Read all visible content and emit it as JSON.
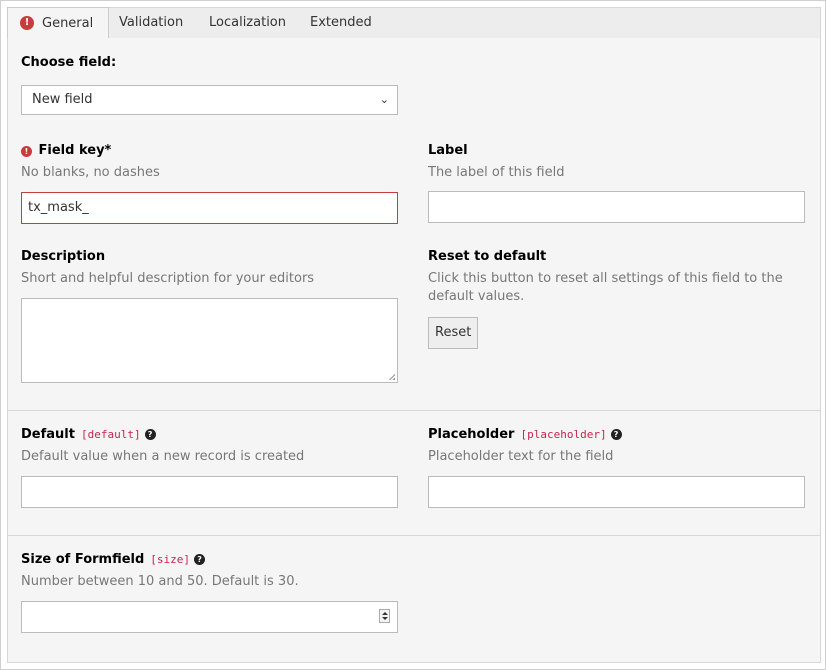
{
  "tabs": [
    {
      "label": "General",
      "active": true,
      "has_error": true
    },
    {
      "label": "Validation"
    },
    {
      "label": "Localization"
    },
    {
      "label": "Extended"
    }
  ],
  "choose_field": {
    "label": "Choose field:",
    "selected": "New field"
  },
  "field_key": {
    "label": "Field key*",
    "description": "No blanks, no dashes",
    "value": "tx_mask_"
  },
  "label_field": {
    "label": "Label",
    "description": "The label of this field",
    "value": ""
  },
  "description_field": {
    "label": "Description",
    "description": "Short and helpful description for your editors",
    "value": ""
  },
  "reset": {
    "label": "Reset to default",
    "description": "Click this button to reset all settings of this field to the default values.",
    "button_label": "Reset"
  },
  "default_field": {
    "label": "Default",
    "code": "[default]",
    "description": "Default value when a new record is created",
    "value": ""
  },
  "placeholder_field": {
    "label": "Placeholder",
    "code": "[placeholder]",
    "description": "Placeholder text for the field",
    "value": ""
  },
  "size_field": {
    "label": "Size of Formfield",
    "code": "[size]",
    "description": "Number between 10 and 50. Default is 30.",
    "value": ""
  },
  "colors": {
    "error": "#c83c3c",
    "code": "#c7254e",
    "panel_bg": "#f5f5f5"
  }
}
